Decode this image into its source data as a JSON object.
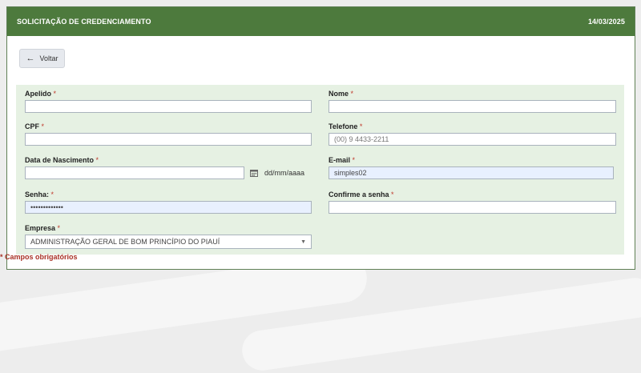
{
  "header": {
    "title": "SOLICITAÇÃO DE CREDENCIAMENTO",
    "date": "14/03/2025"
  },
  "back_button": {
    "label": "Voltar",
    "icon": "arrow-left-icon"
  },
  "form": {
    "apelido": {
      "label": "Apelido",
      "required": "*",
      "value": ""
    },
    "nome": {
      "label": "Nome",
      "required": "*",
      "value": ""
    },
    "cpf": {
      "label": "CPF",
      "required": "*",
      "value": ""
    },
    "telefone": {
      "label": "Telefone",
      "required": "*",
      "placeholder": "(00) 9 4433-2211"
    },
    "nascimento": {
      "label": "Data de Nascimento",
      "required": "*",
      "value": "",
      "format": "dd/mm/aaaa",
      "icon": "calendar-icon"
    },
    "email": {
      "label": "E-mail",
      "required": "*",
      "value": "simples02"
    },
    "senha": {
      "label": "Senha:",
      "required": "*",
      "value": "•••••••••••••"
    },
    "confirme": {
      "label": "Confirme a senha",
      "required": "*",
      "value": ""
    },
    "empresa": {
      "label": "Empresa",
      "required": "*",
      "value": "ADMINISTRAÇÃO GERAL DE BOM PRINCÍPIO DO PIAUÍ"
    }
  },
  "footer_note": "* Campos obrigatórios",
  "colors": {
    "header": "#4d7a3d",
    "form_bg": "#e6f1e3",
    "required": "#c0392b"
  }
}
